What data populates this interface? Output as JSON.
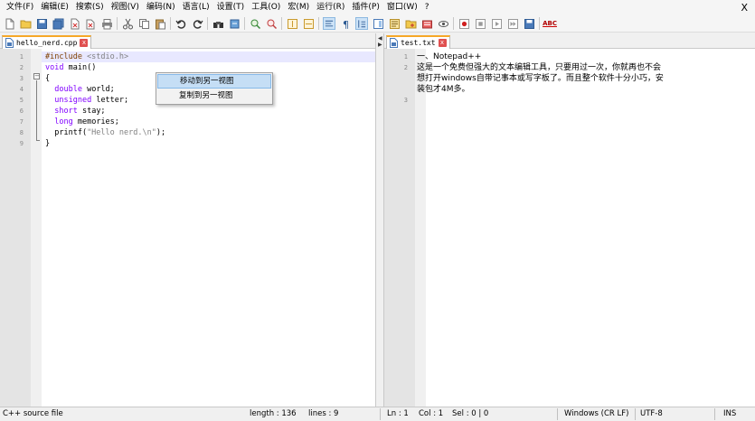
{
  "menu": [
    "文件(F)",
    "编辑(E)",
    "搜索(S)",
    "视图(V)",
    "编码(N)",
    "语言(L)",
    "设置(T)",
    "工具(O)",
    "宏(M)",
    "运行(R)",
    "插件(P)",
    "窗口(W)",
    "?"
  ],
  "window_close": "X",
  "toolbar": {
    "spell_label": "ABC"
  },
  "left_tab": {
    "title": "hello_nerd.cpp",
    "close": "x"
  },
  "right_tab": {
    "title": "test.txt",
    "close": "x"
  },
  "left_lines": [
    {
      "n": "1",
      "parts": [
        [
          "pre",
          "#include "
        ],
        [
          "inc",
          "<stdio.h>"
        ]
      ]
    },
    {
      "n": "2",
      "parts": [
        [
          "kw",
          "void"
        ],
        [
          "",
          " main()"
        ]
      ]
    },
    {
      "n": "3",
      "parts": [
        [
          "",
          "{"
        ]
      ]
    },
    {
      "n": "4",
      "parts": [
        [
          "",
          "  "
        ],
        [
          "kw",
          "double"
        ],
        [
          "",
          " world;"
        ]
      ]
    },
    {
      "n": "5",
      "parts": [
        [
          "",
          "  "
        ],
        [
          "kw",
          "unsigned"
        ],
        [
          "",
          " letter;"
        ]
      ]
    },
    {
      "n": "6",
      "parts": [
        [
          "",
          "  "
        ],
        [
          "kw",
          "short"
        ],
        [
          "",
          " stay;"
        ]
      ]
    },
    {
      "n": "7",
      "parts": [
        [
          "",
          "  "
        ],
        [
          "kw",
          "long"
        ],
        [
          "",
          " memories;"
        ]
      ]
    },
    {
      "n": "8",
      "parts": [
        [
          "",
          "  printf("
        ],
        [
          "str",
          "\"Hello nerd.\\n\""
        ],
        [
          "",
          ");"
        ]
      ]
    },
    {
      "n": "9",
      "parts": [
        [
          "",
          "}"
        ]
      ]
    }
  ],
  "context_menu": {
    "items": [
      "移动到另一视图",
      "复制到另一视图"
    ]
  },
  "right_lines": [
    {
      "n": "1",
      "text": "一、Notepad++"
    },
    {
      "n": "2",
      "text": "这是一个免费但强大的文本编辑工具，只要用过一次，你就再也不会"
    },
    {
      "n": "",
      "text": "想打开windows自带记事本或写字板了。而且整个软件十分小巧，安"
    },
    {
      "n": "",
      "text": "装包才4M多。"
    },
    {
      "n": "3",
      "text": ""
    }
  ],
  "status": {
    "filetype": "C++ source file",
    "length": "length : 136",
    "lines": "lines : 9",
    "ln": "Ln : 1",
    "col": "Col : 1",
    "sel": "Sel : 0 | 0",
    "eol": "Windows (CR LF)",
    "encoding": "UTF-8",
    "mode": "INS"
  }
}
